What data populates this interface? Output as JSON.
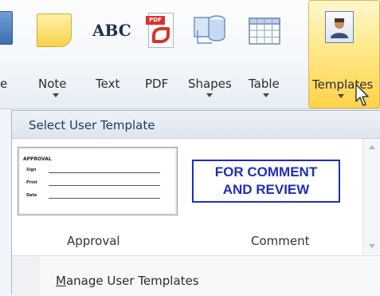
{
  "ribbon": {
    "items": [
      {
        "label": "e",
        "icon": "calendar-partial-icon"
      },
      {
        "label": "Note",
        "icon": "note-icon"
      },
      {
        "label": "Text",
        "icon": "abc-text-icon",
        "icon_text": "ABC"
      },
      {
        "label": "PDF",
        "icon": "pdf-icon",
        "icon_text": "PDF"
      },
      {
        "label": "Shapes",
        "icon": "shapes-icon"
      },
      {
        "label": "Table",
        "icon": "table-icon"
      },
      {
        "label": "Templates",
        "icon": "user-template-icon"
      }
    ]
  },
  "dropdown": {
    "title": "Select User Template",
    "templates": [
      {
        "caption": "Approval",
        "preview_title": "APPROVAL",
        "preview_fields": [
          "Sign",
          "Print",
          "Date"
        ]
      },
      {
        "caption": "Comment",
        "preview_lines": [
          "FOR COMMENT",
          "AND REVIEW"
        ]
      }
    ],
    "manage_prefix": "M",
    "manage_rest": "anage User Templates"
  },
  "colors": {
    "selected_bg": "#ffd24a",
    "stamp_blue": "#1f2fb8",
    "header_text": "#1e395b"
  }
}
